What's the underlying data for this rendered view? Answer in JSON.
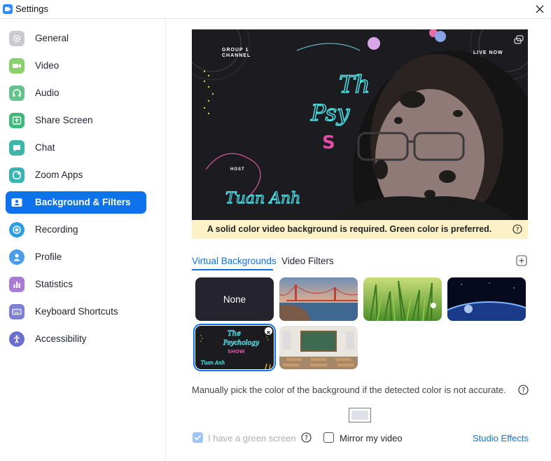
{
  "window": {
    "title": "Settings"
  },
  "sidebar": {
    "items": [
      {
        "label": "General",
        "icon": "gear-icon",
        "color": "#c9c9cf"
      },
      {
        "label": "Video",
        "icon": "video-camera-icon",
        "color": "#8bd16b"
      },
      {
        "label": "Audio",
        "icon": "headphones-icon",
        "color": "#62c48a"
      },
      {
        "label": "Share Screen",
        "icon": "share-screen-icon",
        "color": "#3fba7d"
      },
      {
        "label": "Chat",
        "icon": "chat-icon",
        "color": "#3bb8a9"
      },
      {
        "label": "Zoom Apps",
        "icon": "apps-icon",
        "color": "#38b4b4"
      },
      {
        "label": "Background & Filters",
        "icon": "person-card-icon",
        "color": "#0e72ed",
        "active": true
      },
      {
        "label": "Recording",
        "icon": "record-icon",
        "color": "#2d9fe0"
      },
      {
        "label": "Profile",
        "icon": "profile-icon",
        "color": "#4a9de8"
      },
      {
        "label": "Statistics",
        "icon": "bar-chart-icon",
        "color": "#a97bd6"
      },
      {
        "label": "Keyboard Shortcuts",
        "icon": "keyboard-icon",
        "color": "#7d7ed8"
      },
      {
        "label": "Accessibility",
        "icon": "accessibility-icon",
        "color": "#6a6fcf"
      }
    ]
  },
  "preview": {
    "overlay_text": {
      "group": "GROUP 1",
      "channel": "CHANNEL",
      "live": "LIVE NOW",
      "host": "HOST"
    }
  },
  "warning": {
    "text": "A solid color video background is required. Green color is preferred."
  },
  "tabs": {
    "virtual_backgrounds": "Virtual Backgrounds",
    "video_filters": "Video Filters"
  },
  "backgrounds": {
    "none_label": "None",
    "items": [
      "none",
      "golden-gate-bridge",
      "grass",
      "earth-from-space",
      "psychology-show",
      "classroom"
    ],
    "selected": "psychology-show"
  },
  "note": {
    "text": "Manually pick the color of the background if the detected color is not accurate."
  },
  "options": {
    "green_screen": "I have a green screen",
    "green_screen_checked": true,
    "green_screen_disabled": true,
    "mirror": "Mirror my video",
    "mirror_checked": false,
    "studio_effects": "Studio Effects"
  },
  "colors": {
    "accent": "#0e72ed",
    "warning_bg": "#fdf1c7",
    "picked_color": "#dfe0e8"
  }
}
